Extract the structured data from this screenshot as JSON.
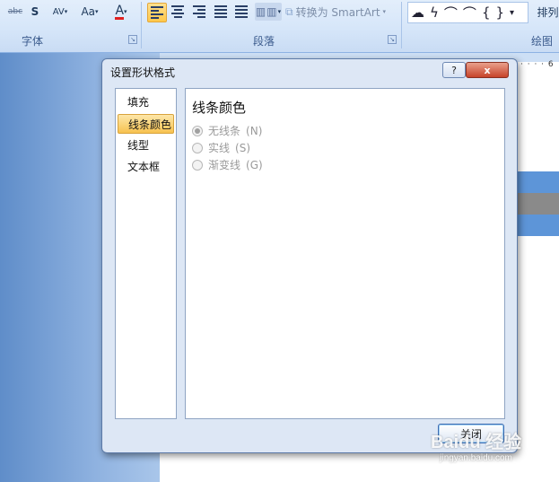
{
  "ribbon": {
    "font_group": {
      "label": "字体",
      "strike_label": "abc",
      "bold_shadow_label": "S",
      "spacing_label": "AV",
      "case_label": "Aa",
      "font_color_label": "A",
      "font_color": "#e02020"
    },
    "paragraph_group": {
      "label": "段落",
      "smartart_label": "转换为 SmartArt"
    },
    "drawing_group": {
      "label": "绘图",
      "arrange_label": "排列"
    }
  },
  "ruler": {
    "number": "6"
  },
  "dialog": {
    "title": "设置形状格式",
    "help_label": "?",
    "close_icon_label": "x",
    "nav": [
      {
        "label": "填充",
        "selected": false
      },
      {
        "label": "线条颜色",
        "selected": true
      },
      {
        "label": "线型",
        "selected": false
      },
      {
        "label": "文本框",
        "selected": false
      }
    ],
    "section_title": "线条颜色",
    "options": [
      {
        "label": "无线条",
        "key": "N",
        "checked": true
      },
      {
        "label": "实线",
        "key": "S",
        "checked": false
      },
      {
        "label": "渐变线",
        "key": "G",
        "checked": false
      }
    ],
    "close_button_label": "关闭"
  },
  "watermark": {
    "logo": "Baidu 经验",
    "url": "jingyan.baidu.com"
  },
  "colors": {
    "accent": "#f7c250",
    "ribbon_bg": "#d6e6f9",
    "dialog_bg": "#dde7f5",
    "doc_bg": "#8fb2e0"
  }
}
